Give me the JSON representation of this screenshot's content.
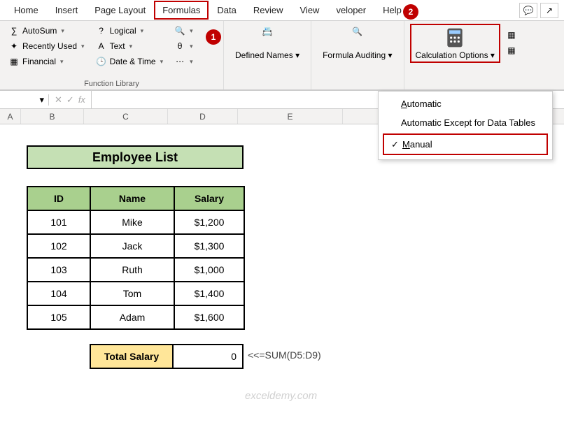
{
  "tabs": {
    "home": "Home",
    "insert": "Insert",
    "page_layout": "Page Layout",
    "formulas": "Formulas",
    "data": "Data",
    "review": "Review",
    "view": "View",
    "developer": "veloper",
    "help": "Help"
  },
  "ribbon": {
    "autosum": "AutoSum",
    "recently_used": "Recently Used",
    "financial": "Financial",
    "logical": "Logical",
    "text": "Text",
    "date_time": "Date & Time",
    "defined_names": "Defined Names",
    "formula_auditing": "Formula Auditing",
    "calculation_options": "Calculation Options",
    "function_library": "Function Library"
  },
  "menu": {
    "automatic": "Automatic",
    "auto_except": "Automatic Except for Data Tables",
    "manual": "Manual"
  },
  "callouts": {
    "one": "1",
    "two": "2"
  },
  "cols": {
    "a": "A",
    "b": "B",
    "c": "C",
    "d": "D",
    "e": "E"
  },
  "formula_bar": {
    "fx": "fx",
    "chev": "▾",
    "x": "✕",
    "check": "✓"
  },
  "sheet": {
    "title": "Employee List",
    "headers": {
      "id": "ID",
      "name": "Name",
      "salary": "Salary"
    },
    "rows": [
      {
        "id": "101",
        "name": "Mike",
        "salary": "$1,200"
      },
      {
        "id": "102",
        "name": "Jack",
        "salary": "$1,300"
      },
      {
        "id": "103",
        "name": "Ruth",
        "salary": "$1,000"
      },
      {
        "id": "104",
        "name": "Tom",
        "salary": "$1,400"
      },
      {
        "id": "105",
        "name": "Adam",
        "salary": "$1,600"
      }
    ],
    "total_label": "Total Salary",
    "total_value": "0",
    "total_note": "<<=SUM(D5:D9)"
  },
  "watermark": "exceldemy.com"
}
